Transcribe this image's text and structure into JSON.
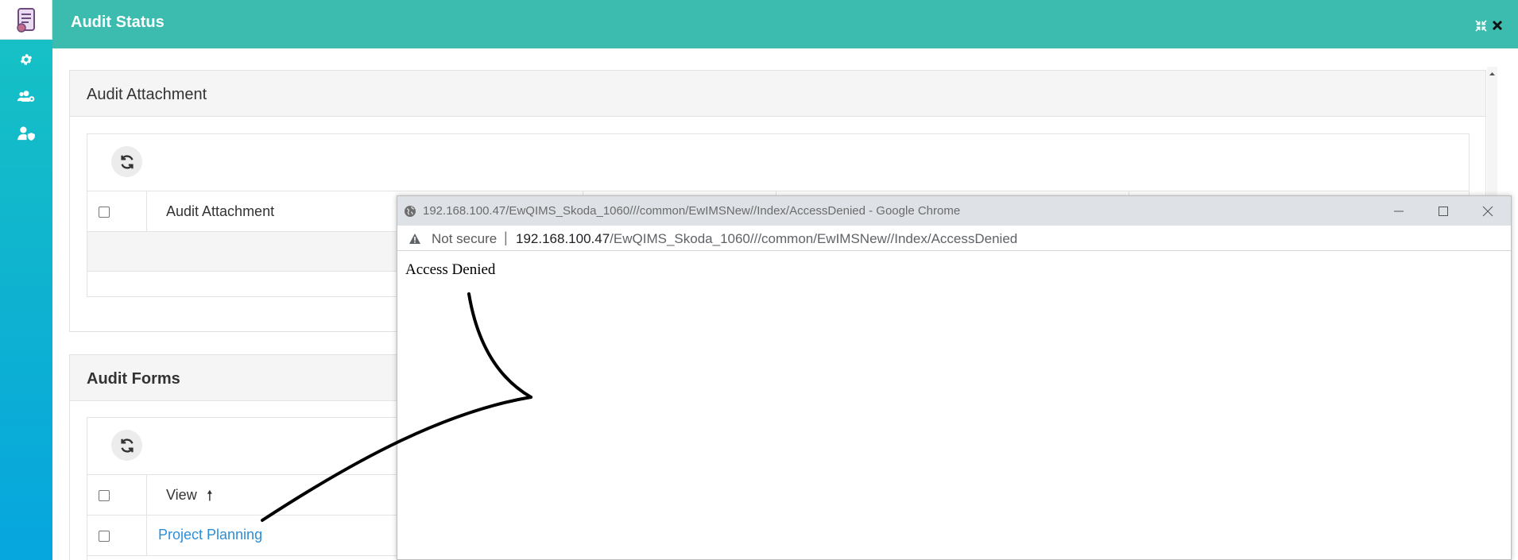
{
  "header": {
    "title": "Audit Status"
  },
  "sidebar": {
    "items": [
      {
        "icon": "gear-icon"
      },
      {
        "icon": "users-cog-icon"
      },
      {
        "icon": "user-shield-icon"
      }
    ]
  },
  "attachment_panel": {
    "title": "Audit Attachment",
    "column_header": "Audit Attachment"
  },
  "forms_panel": {
    "title": "Audit Forms",
    "column_header": "View",
    "sort_indicator": "🠕",
    "rows": [
      {
        "link": "Project Planning"
      }
    ]
  },
  "popup": {
    "window_title": "192.168.100.47/EwQIMS_Skoda_1060///common/EwIMSNew//Index/AccessDenied - Google Chrome",
    "security_label": "Not secure",
    "separator": "|",
    "url_host": "192.168.100.47",
    "url_path": "/EwQIMS_Skoda_1060///common/EwIMSNew//Index/AccessDenied",
    "content_text": "Access Denied"
  },
  "colors": {
    "header": "#3bbcae",
    "sidebar_top": "#17c3c4",
    "sidebar_bottom": "#06a6df",
    "link": "#2d8ed8"
  }
}
